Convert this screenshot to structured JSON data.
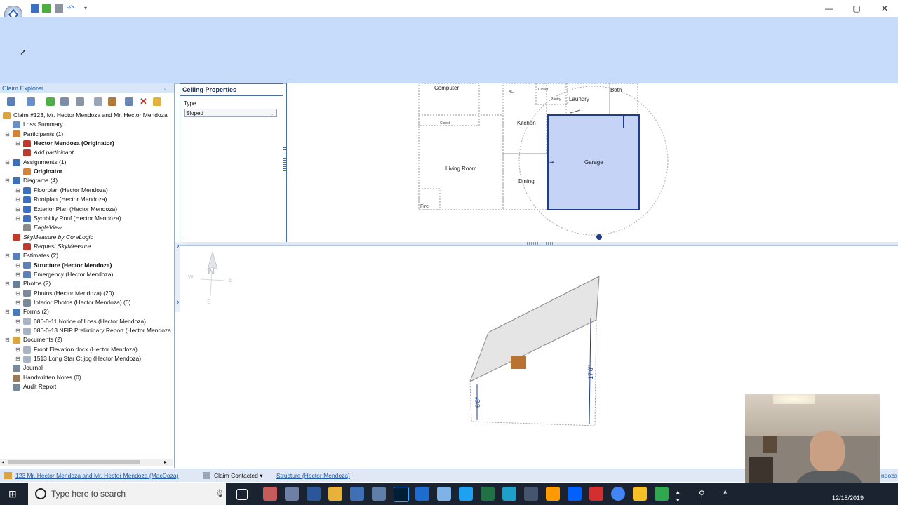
{
  "window": {
    "quick_access_icons": [
      "app-logo-icon",
      "save-icon",
      "refresh-icon",
      "print-icon",
      "undo-icon",
      "customize-dropdown-icon"
    ],
    "controls": {
      "minimize": "—",
      "maximize": "▢",
      "close": "✕"
    }
  },
  "explorer": {
    "title": "Claim Explorer",
    "pin": "▫",
    "root": "Claim #123, Mr. Hector Mendoza and Mr. Hector Mendoza",
    "items": [
      {
        "label": "Loss Summary",
        "style": ""
      },
      {
        "label": "Participants (1)",
        "style": ""
      },
      {
        "label": "Hector Mendoza (Originator)",
        "style": "bold"
      },
      {
        "label": "Add participant",
        "style": "ital"
      },
      {
        "label": "Assignments (1)",
        "style": ""
      },
      {
        "label": "Originator",
        "style": "bold"
      },
      {
        "label": "Diagrams (4)",
        "style": ""
      },
      {
        "label": "Floorplan (Hector Mendoza)",
        "style": ""
      },
      {
        "label": "Roofplan (Hector Mendoza)",
        "style": ""
      },
      {
        "label": "Exterior Plan (Hector Mendoza)",
        "style": ""
      },
      {
        "label": "Symbility Roof (Hector Mendoza)",
        "style": ""
      },
      {
        "label": "EagleView",
        "style": "ital"
      },
      {
        "label": "SkyMeasure by CoreLogic",
        "style": "ital"
      },
      {
        "label": "Request SkyMeasure",
        "style": "ital"
      },
      {
        "label": "Estimates (2)",
        "style": ""
      },
      {
        "label": "Structure (Hector Mendoza)",
        "style": "bold"
      },
      {
        "label": "Emergency (Hector Mendoza)",
        "style": ""
      },
      {
        "label": "Photos (2)",
        "style": ""
      },
      {
        "label": "Photos (Hector Mendoza) (20)",
        "style": ""
      },
      {
        "label": "Interior Photos (Hector Mendoza) (0)",
        "style": ""
      },
      {
        "label": "Forms (2)",
        "style": ""
      },
      {
        "label": "086-0-11 Notice of Loss (Hector Mendoza)",
        "style": ""
      },
      {
        "label": "086-0-13 NFIP Preliminary Report (Hector Mendoza",
        "style": ""
      },
      {
        "label": "Documents (2)",
        "style": ""
      },
      {
        "label": "Front Elevation.docx (Hector Mendoza)",
        "style": ""
      },
      {
        "label": "1513 Long Star Ct.jpg (Hector Mendoza)",
        "style": ""
      },
      {
        "label": "Journal",
        "style": ""
      },
      {
        "label": "Handwritten Notes (0)",
        "style": ""
      },
      {
        "label": "Audit Report",
        "style": ""
      }
    ]
  },
  "ceiling_properties": {
    "title": "Ceiling Properties",
    "type_label": "Type",
    "type_value": "Sloped"
  },
  "floorplan": {
    "rooms": {
      "computer": "Computer",
      "closet1": "Closet",
      "ac": "AC",
      "closet2": "Closet",
      "pantry": "Pantry",
      "laundry": "Laundry",
      "bath": "Bath",
      "kitchen": "Kitchen",
      "living": "Living Room",
      "dining": "Dining",
      "garage": "Garage",
      "fire": "Fire"
    },
    "garage_fill": "#c5d3f6"
  },
  "view3d": {
    "compass": {
      "n": "N",
      "s": "S",
      "e": "E",
      "w": "W"
    },
    "side_tab_label": "Items",
    "dim_left": "6'8\"",
    "dim_right": "17'8\""
  },
  "status": {
    "claim_link": "123 Mr. Hector Mendoza and Mr. Hector Mendoza (MacDoza)",
    "claim_status": "Claim Contacted",
    "estimate_link": "Structure (Hector Mendoza)",
    "right_fragment": "ndoza"
  },
  "taskbar": {
    "search_placeholder": "Type here to search",
    "date": "12/18/2019"
  }
}
